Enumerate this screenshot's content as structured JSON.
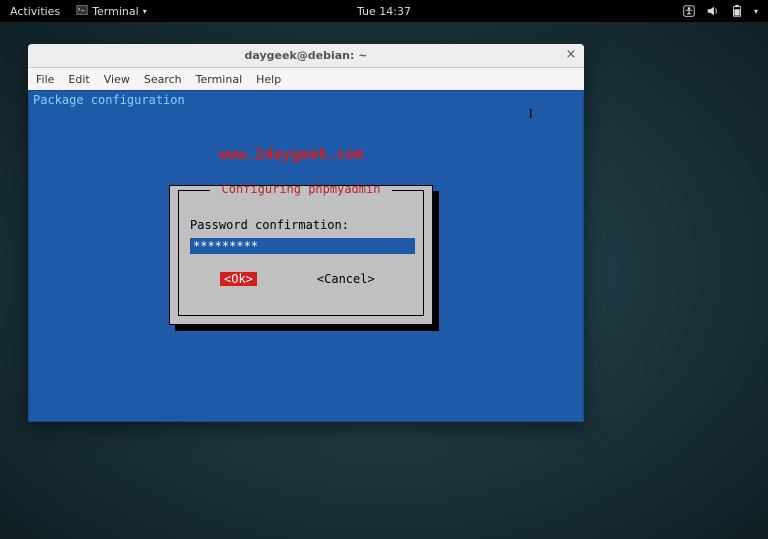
{
  "topbar": {
    "activities": "Activities",
    "appmenu_label": "Terminal",
    "clock": "Tue 14:37"
  },
  "window": {
    "title": "daygeek@debian: ~",
    "menus": {
      "file": "File",
      "edit": "Edit",
      "view": "View",
      "search": "Search",
      "terminal": "Terminal",
      "help": "Help"
    }
  },
  "terminal": {
    "header_line": "Package configuration",
    "watermark": "www.2daygeek.com"
  },
  "dialog": {
    "title": "Configuring phpmyadmin",
    "prompt": "Password confirmation:",
    "input_value": "*********",
    "ok": "<Ok>",
    "cancel": "<Cancel>"
  }
}
